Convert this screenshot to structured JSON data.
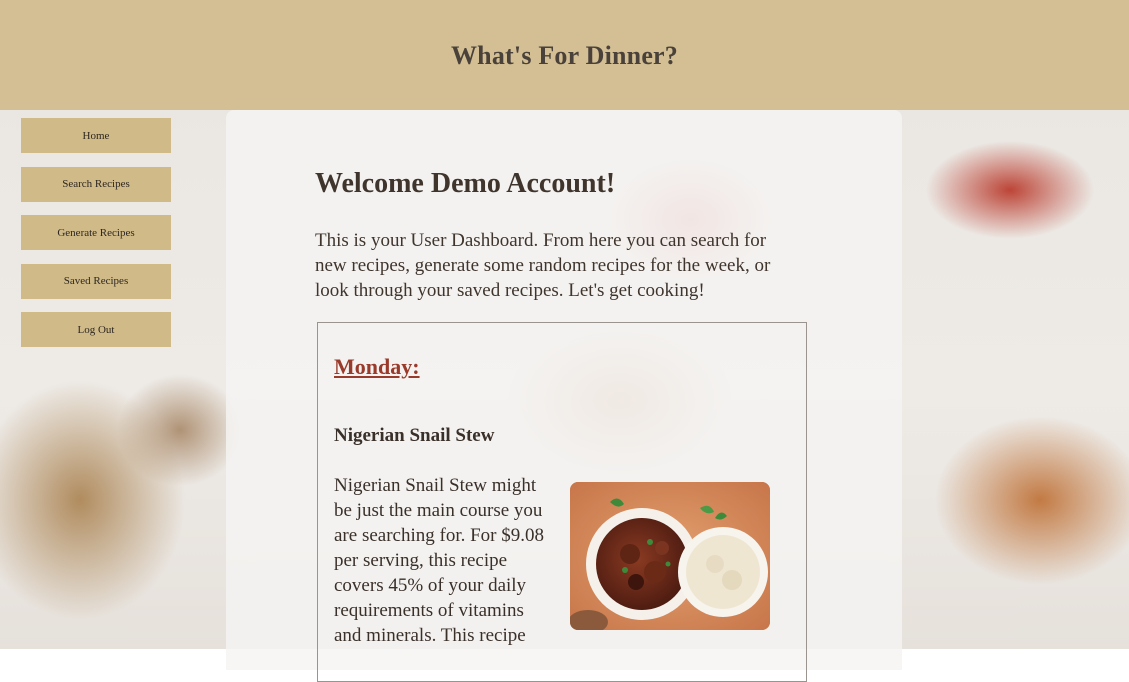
{
  "header": {
    "title": "What's For Dinner?"
  },
  "sidebar": {
    "items": [
      {
        "label": "Home"
      },
      {
        "label": "Search Recipes"
      },
      {
        "label": "Generate Recipes"
      },
      {
        "label": "Saved Recipes"
      },
      {
        "label": "Log Out"
      }
    ]
  },
  "main": {
    "welcome": "Welcome Demo Account!",
    "intro": "This is your User Dashboard. From here you can search for new recipes, generate some random recipes for the week, or look through your saved recipes. Let's get cooking!",
    "day": {
      "title": "Monday:",
      "recipe_name": "Nigerian Snail Stew",
      "recipe_description": "Nigerian Snail Stew might be just the main course you are searching for. For $9.08 per serving, this recipe covers 45% of your daily requirements of vitamins and minerals. This recipe",
      "image_icon": "stew-photo"
    }
  },
  "colors": {
    "header_bg": "#cfba88",
    "nav_button_bg": "#cfba88",
    "day_title": "#9a3a2a",
    "text": "#3f352d"
  }
}
